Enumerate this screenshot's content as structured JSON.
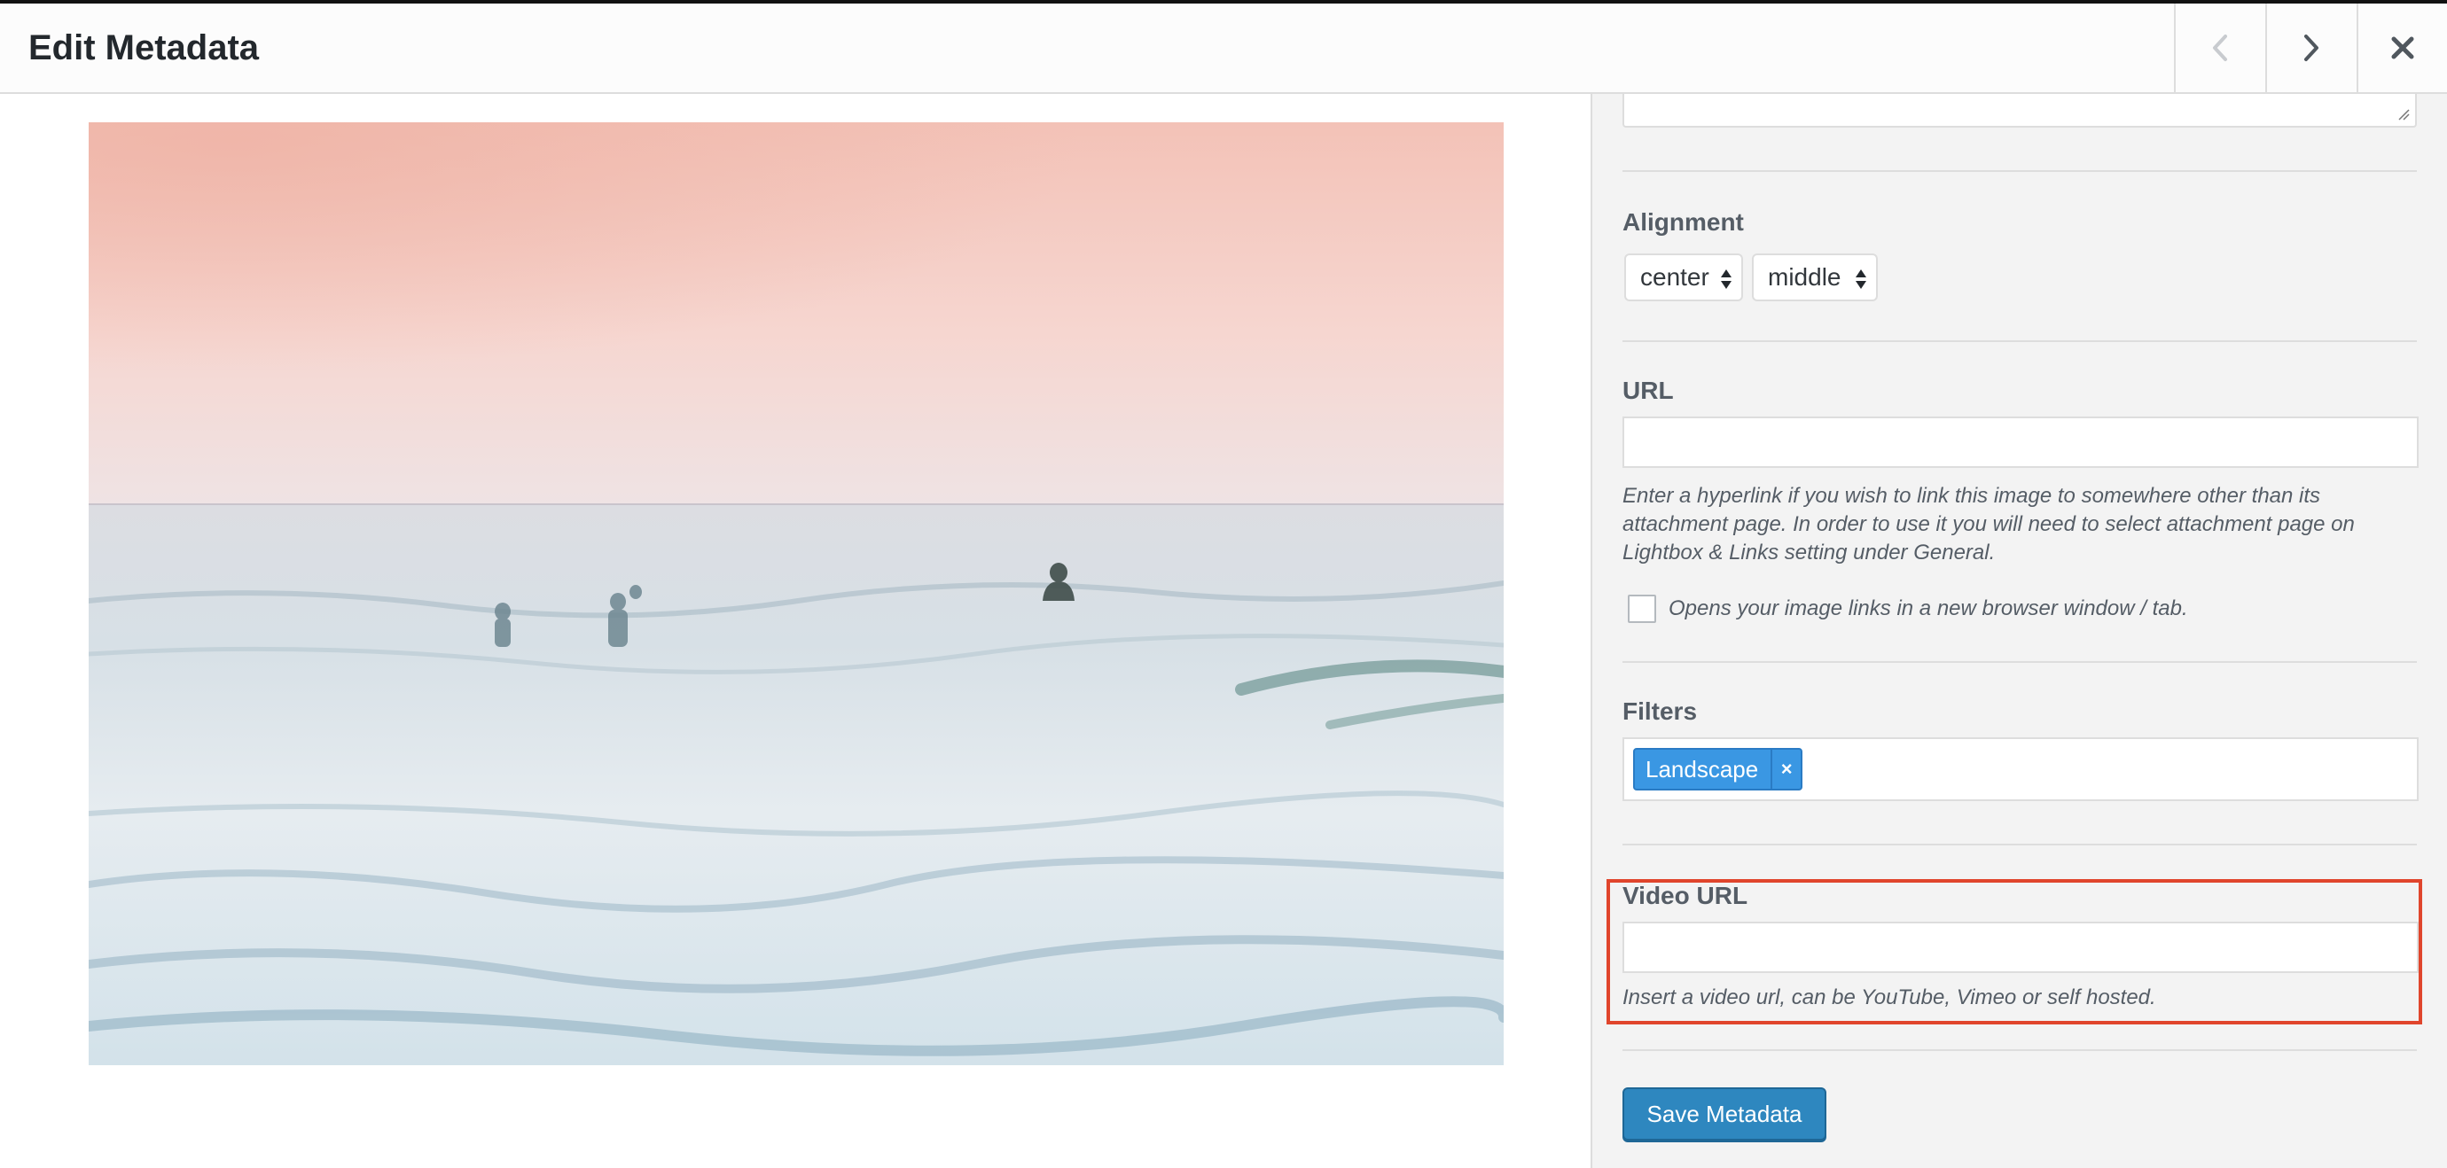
{
  "header": {
    "title": "Edit Metadata",
    "prev_icon": "chevron-left-icon",
    "next_icon": "chevron-right-icon",
    "close_icon": "close-icon"
  },
  "sidebar": {
    "alignment": {
      "label": "Alignment",
      "horizontal_value": "center",
      "vertical_value": "middle"
    },
    "url": {
      "label": "URL",
      "value": "",
      "help": "Enter a hyperlink if you wish to link this image to somewhere other than its attachment page. In order to use it you will need to select attachment page on Lightbox & Links setting under General.",
      "new_window_label": "Opens your image links in a new browser window / tab.",
      "new_window_checked": false
    },
    "filters": {
      "label": "Filters",
      "tags": [
        "Landscape"
      ],
      "remove_symbol": "×"
    },
    "video_url": {
      "label": "Video URL",
      "value": "",
      "help": "Insert a video url, can be YouTube, Vimeo or self hosted."
    },
    "save_label": "Save Metadata"
  },
  "colors": {
    "highlight": "#e0452c",
    "primary_button": "#2e87bf",
    "tag": "#3a97e3"
  }
}
